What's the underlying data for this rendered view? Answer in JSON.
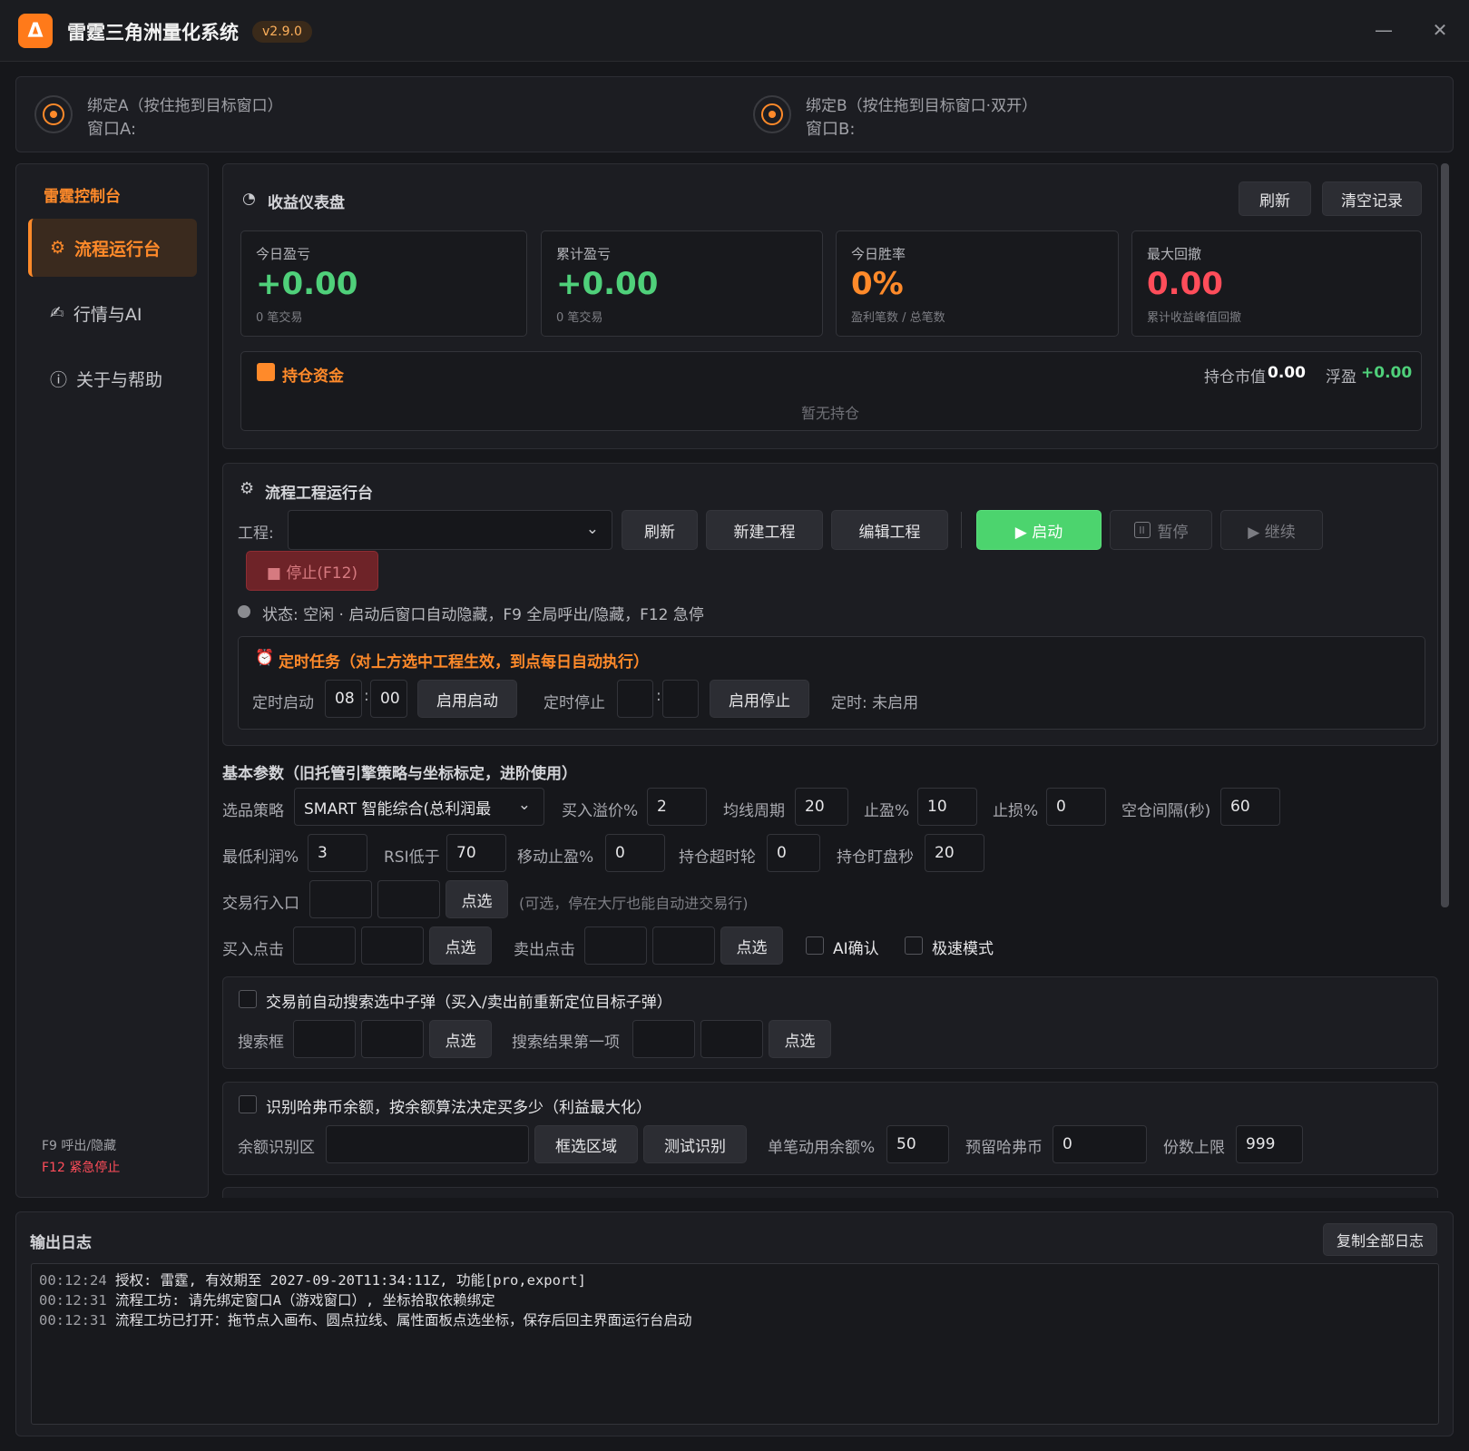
{
  "app": {
    "logo_letter": "Δ",
    "title": "雷霆三角洲量化系统",
    "version": "v2.9.0",
    "minimize": "—",
    "close": "✕"
  },
  "binding": {
    "a_label": "绑定A（按住拖到目标窗口）",
    "a_window": "窗口A:",
    "b_label": "绑定B（按住拖到目标窗口·双开）",
    "b_window": "窗口B:"
  },
  "sidebar": {
    "title": "雷霆控制台",
    "items": [
      {
        "label": "流程运行台",
        "icon": "⚙"
      },
      {
        "label": "行情与AI",
        "icon": "✍"
      },
      {
        "label": "关于与帮助",
        "icon": "ⓘ"
      }
    ],
    "hotkey_f9": "F9 呼出/隐藏",
    "hotkey_f12": "F12 紧急停止"
  },
  "dashboard": {
    "title": "收益仪表盘",
    "refresh": "刷新",
    "clear": "清空记录",
    "cards": [
      {
        "label": "今日盈亏",
        "value": "+0.00",
        "sub": "0 笔交易",
        "color": "#4fd07a"
      },
      {
        "label": "累计盈亏",
        "value": "+0.00",
        "sub": "0 笔交易",
        "color": "#4fd07a"
      },
      {
        "label": "今日胜率",
        "value": "0%",
        "sub": "盈利笔数 / 总笔数",
        "color": "#ff8a2a"
      },
      {
        "label": "最大回撤",
        "value": "0.00",
        "sub": "累计收益峰值回撤",
        "color": "#ff4d5a"
      }
    ],
    "holdings": {
      "title": "持仓资金",
      "market_label": "持仓市值",
      "market_value": "0.00",
      "float_label": "浮盈",
      "float_value": "+0.00",
      "empty": "暂无持仓"
    }
  },
  "workflow": {
    "title": "流程工程运行台",
    "project_label": "工程:",
    "project_value": "",
    "refresh": "刷新",
    "new_project": "新建工程",
    "edit_project": "编辑工程",
    "start": "▶ 启动",
    "pause": "暂停",
    "resume": "▶ 继续",
    "stop": "■ 停止(F12)",
    "status": "状态: 空闲 · 启动后窗口自动隐藏，F9 全局呼出/隐藏，F12 急停",
    "schedule": {
      "title": "定时任务（对上方选中工程生效，到点每日自动执行）",
      "start_label": "定时启动",
      "start_hour": "08",
      "start_min": "00",
      "enable_start": "启用启动",
      "stop_label": "定时停止",
      "stop_hour": "",
      "stop_min": "",
      "enable_stop": "启用停止",
      "state": "定时: 未启用"
    }
  },
  "params": {
    "title": "基本参数（旧托管引擎策略与坐标标定，进阶使用）",
    "strategy_label": "选品策略",
    "strategy_value": "SMART 智能综合(总利润最",
    "buy_premium_label": "买入溢价%",
    "buy_premium": "2",
    "ma_label": "均线周期",
    "ma": "20",
    "tp_label": "止盈%",
    "tp": "10",
    "sl_label": "止损%",
    "sl": "0",
    "idle_label": "空仓间隔(秒)",
    "idle": "60",
    "min_profit_label": "最低利润%",
    "min_profit": "3",
    "rsi_label": "RSI低于",
    "rsi": "70",
    "trailing_label": "移动止盈%",
    "trailing": "0",
    "timeout_label": "持仓超时轮",
    "timeout": "0",
    "watch_label": "持仓盯盘秒",
    "watch": "20",
    "entry_label": "交易行入口",
    "pick": "点选",
    "entry_hint": "(可选，停在大厅也能自动进交易行)",
    "buy_click_label": "买入点击",
    "sell_click_label": "卖出点击",
    "ai_confirm": "AI确认",
    "fast_mode": "极速模式"
  },
  "search": {
    "title": "交易前自动搜索选中子弹（买入/卖出前重新定位目标子弹）",
    "box_label": "搜索框",
    "result_label": "搜索结果第一项",
    "pick": "点选"
  },
  "balance": {
    "title": "识别哈弗币余额，按余额算法决定买多少（利益最大化）",
    "area_label": "余额识别区",
    "select_area": "框选区域",
    "test": "测试识别",
    "ratio_label": "单笔动用余额%",
    "ratio": "50",
    "reserve_label": "预留哈弗币",
    "reserve": "0",
    "max_label": "份数上限",
    "max": "999"
  },
  "log": {
    "title": "输出日志",
    "copy": "复制全部日志",
    "lines": [
      {
        "time": "00:12:24",
        "text": "授权: 雷霆, 有效期至 2027-09-20T11:34:11Z, 功能[pro,export]"
      },
      {
        "time": "00:12:31",
        "text": "流程工坊: 请先绑定窗口A（游戏窗口）, 坐标拾取依赖绑定"
      },
      {
        "time": "00:12:31",
        "text": "流程工坊已打开：拖节点入画布、圆点拉线、属性面板点选坐标，保存后回主界面运行台启动"
      }
    ]
  }
}
